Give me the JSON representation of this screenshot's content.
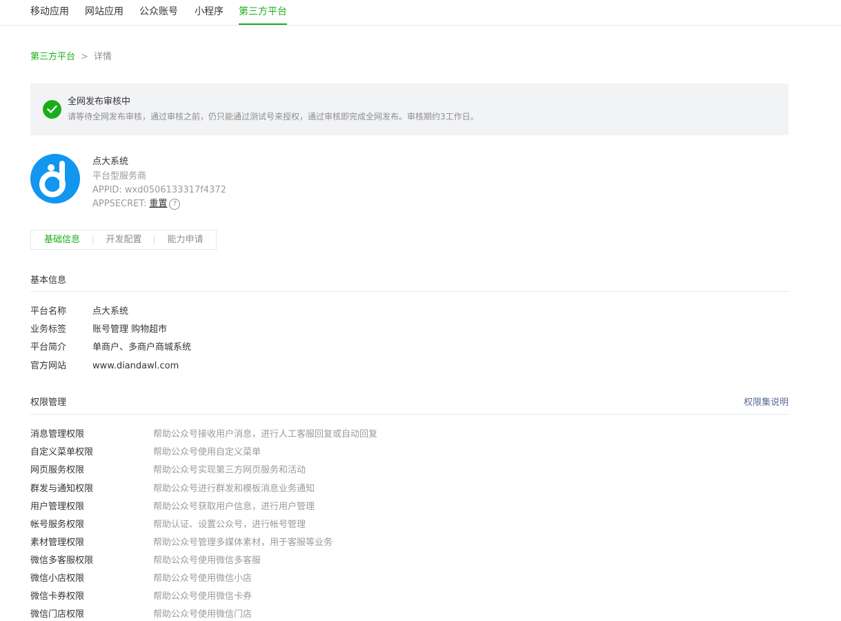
{
  "topnav": {
    "tabs": [
      {
        "label": "移动应用"
      },
      {
        "label": "网站应用"
      },
      {
        "label": "公众账号"
      },
      {
        "label": "小程序"
      },
      {
        "label": "第三方平台",
        "active": true
      }
    ]
  },
  "breadcrumb": {
    "parent": "第三方平台",
    "separator": ">",
    "current": "详情"
  },
  "notice": {
    "icon": "check-circle-icon",
    "title": "全网发布审核中",
    "description": "请等待全网发布审核，通过审核之前，仍只能通过测试号来授权，通过审核即完成全网发布。审核期约3工作日。"
  },
  "account": {
    "name": "点大系统",
    "type": "平台型服务商",
    "appid": "APPID: wxd0506133317f4372",
    "appsecret_label": "APPSECRET:",
    "appsecret_action": "重置",
    "help_icon": "?"
  },
  "subtabs": [
    {
      "label": "基础信息",
      "active": true
    },
    {
      "label": "开发配置"
    },
    {
      "label": "能力申请"
    }
  ],
  "basic_info": {
    "title": "基本信息",
    "rows": [
      {
        "key": "平台名称",
        "value": "点大系统"
      },
      {
        "key": "业务标签",
        "value": "账号管理 购物超市"
      },
      {
        "key": "平台简介",
        "value": "单商户、多商户商城系统"
      },
      {
        "key": "官方网站",
        "value": "www.diandawl.com"
      }
    ]
  },
  "permissions": {
    "title": "权限管理",
    "link": "权限集说明",
    "rows": [
      {
        "key": "消息管理权限",
        "value": "帮助公众号接收用户消息，进行人工客服回复或自动回复"
      },
      {
        "key": "自定义菜单权限",
        "value": "帮助公众号使用自定义菜单"
      },
      {
        "key": "网页服务权限",
        "value": "帮助公众号实现第三方网页服务和活动"
      },
      {
        "key": "群发与通知权限",
        "value": "帮助公众号进行群发和模板消息业务通知"
      },
      {
        "key": "用户管理权限",
        "value": "帮助公众号获取用户信息，进行用户管理"
      },
      {
        "key": "帐号服务权限",
        "value": "帮助认证、设置公众号，进行帐号管理"
      },
      {
        "key": "素材管理权限",
        "value": "帮助公众号管理多媒体素材，用于客服等业务"
      },
      {
        "key": "微信多客服权限",
        "value": "帮助公众号使用微信多客服"
      },
      {
        "key": "微信小店权限",
        "value": "帮助公众号使用微信小店"
      },
      {
        "key": "微信卡券权限",
        "value": "帮助公众号使用微信卡券"
      },
      {
        "key": "微信门店权限",
        "value": "帮助公众号使用微信门店"
      }
    ]
  },
  "colors": {
    "accent": "#1aad19",
    "link": "#576b95",
    "notice_bg": "#f2f3f5",
    "logo": "#1296f0"
  }
}
